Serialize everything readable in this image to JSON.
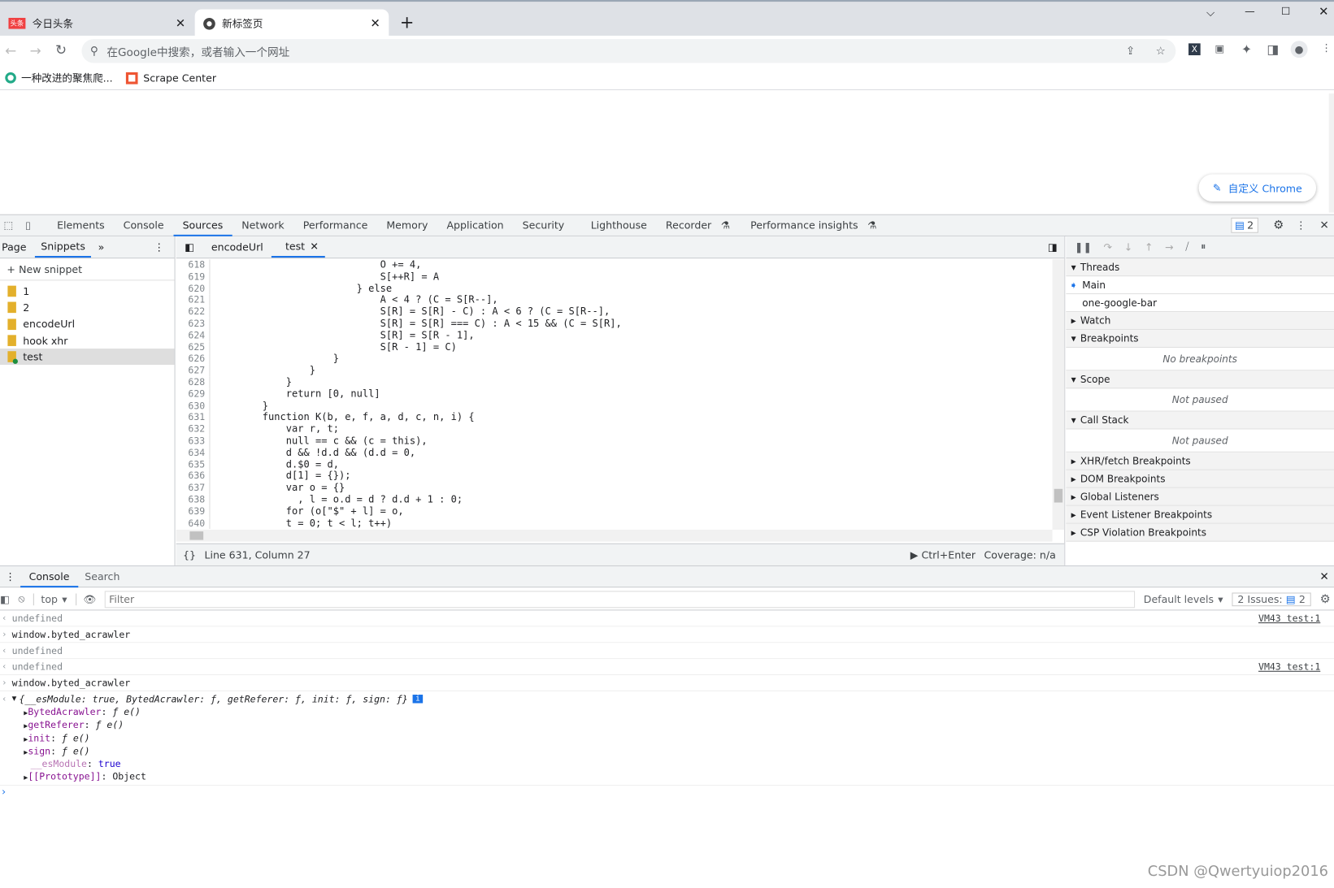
{
  "browser": {
    "tabs": [
      {
        "label": "今日头条",
        "icon": "toutiao-icon"
      },
      {
        "label": "新标签页",
        "icon": "chrome-icon",
        "active": true
      }
    ],
    "omnibox_placeholder": "在Google中搜索，或者输入一个网址",
    "bookmarks": [
      {
        "label": "一种改进的聚焦爬..."
      },
      {
        "label": "Scrape Center"
      }
    ],
    "customize_label": "自定义 Chrome"
  },
  "devtools": {
    "tabs": [
      "Elements",
      "Console",
      "Sources",
      "Network",
      "Performance",
      "Memory",
      "Application",
      "Security",
      "Lighthouse",
      "Recorder",
      "Performance insights"
    ],
    "active_tab": "Sources",
    "issues_count": "2",
    "navigator": {
      "tabs": [
        "Page",
        "Snippets"
      ],
      "new_snippet": "New snippet",
      "snippets": [
        "1",
        "2",
        "encodeUrl",
        "hook xhr",
        "test"
      ],
      "selected": "test"
    },
    "editor": {
      "tabs": [
        "encodeUrl",
        "test"
      ],
      "active": "test",
      "lines": [
        {
          "n": "618",
          "t": "                            O += 4,"
        },
        {
          "n": "619",
          "t": "                            S[++R] = A"
        },
        {
          "n": "620",
          "t": "                        } else"
        },
        {
          "n": "621",
          "t": "                            A < 4 ? (C = S[R--],"
        },
        {
          "n": "622",
          "t": "                            S[R] = S[R] - C) : A < 6 ? (C = S[R--],"
        },
        {
          "n": "623",
          "t": "                            S[R] = S[R] === C) : A < 15 && (C = S[R],"
        },
        {
          "n": "624",
          "t": "                            S[R] = S[R - 1],"
        },
        {
          "n": "625",
          "t": "                            S[R - 1] = C)"
        },
        {
          "n": "626",
          "t": "                    }"
        },
        {
          "n": "627",
          "t": "                }"
        },
        {
          "n": "628",
          "t": "            }"
        },
        {
          "n": "629",
          "t": "            return [0, null]"
        },
        {
          "n": "630",
          "t": "        }"
        },
        {
          "n": "631",
          "t": "        function K(b, e, f, a, d, c, n, i) {"
        },
        {
          "n": "632",
          "t": "            var r, t;"
        },
        {
          "n": "633",
          "t": "            null == c && (c = this),"
        },
        {
          "n": "634",
          "t": "            d && !d.d && (d.d = 0,"
        },
        {
          "n": "635",
          "t": "            d.$0 = d,"
        },
        {
          "n": "636",
          "t": "            d[1] = {});"
        },
        {
          "n": "637",
          "t": "            var o = {}"
        },
        {
          "n": "638",
          "t": "              , l = o.d = d ? d.d + 1 : 0;"
        },
        {
          "n": "639",
          "t": "            for (o[\"$\" + l] = o,"
        },
        {
          "n": "640",
          "t": "            t = 0; t < l; t++)"
        }
      ],
      "status": "Line 631, Column 27",
      "run_hint": "Ctrl+Enter",
      "coverage": "Coverage: n/a"
    },
    "debugger": {
      "threads_label": "Threads",
      "threads": [
        "Main",
        "one-google-bar"
      ],
      "watch_label": "Watch",
      "breakpoints_label": "Breakpoints",
      "breakpoints_empty": "No breakpoints",
      "scope_label": "Scope",
      "scope_empty": "Not paused",
      "callstack_label": "Call Stack",
      "callstack_empty": "Not paused",
      "more_sections": [
        "XHR/fetch Breakpoints",
        "DOM Breakpoints",
        "Global Listeners",
        "Event Listener Breakpoints",
        "CSP Violation Breakpoints"
      ]
    },
    "drawer": {
      "tabs": [
        "Console",
        "Search"
      ],
      "context": "top",
      "filter_placeholder": "Filter",
      "levels": "Default levels",
      "issues": "2 Issues:",
      "issues_count": "2",
      "messages": [
        {
          "type": "out",
          "text": "undefined",
          "link": "VM43 test:1"
        },
        {
          "type": "in",
          "text": "window.byted_acrawler"
        },
        {
          "type": "out",
          "text": "undefined"
        },
        {
          "type": "out",
          "text": "undefined",
          "link": "VM43 test:1"
        },
        {
          "type": "in",
          "text": "window.byted_acrawler"
        }
      ],
      "object_summary": "{__esModule: true, BytedAcrawler: ƒ, getReferer: ƒ, init: ƒ, sign: ƒ}",
      "props": [
        {
          "k": "BytedAcrawler",
          "v": "ƒ e()"
        },
        {
          "k": "getReferer",
          "v": "ƒ e()"
        },
        {
          "k": "init",
          "v": "ƒ e()"
        },
        {
          "k": "sign",
          "v": "ƒ e()"
        },
        {
          "k": "__esModule",
          "v": "true"
        },
        {
          "k": "[[Prototype]]",
          "v": "Object"
        }
      ]
    }
  },
  "watermark": "CSDN @Qwertyuiop2016",
  "colors": {
    "accent": "#1a73e8"
  }
}
